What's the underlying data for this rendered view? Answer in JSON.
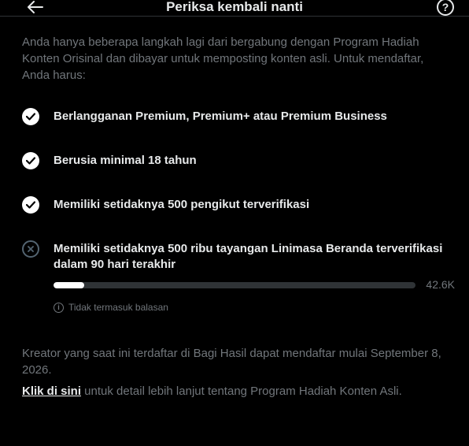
{
  "header": {
    "title": "Periksa kembali nanti",
    "help_label": "?"
  },
  "intro": "Anda hanya beberapa langkah lagi dari bergabung dengan Program Hadiah Konten Orisinal dan dibayar untuk memposting konten asli. Untuk mendaftar, Anda harus:",
  "requirements": [
    {
      "label": "Berlangganan Premium, Premium+ atau Premium Business",
      "status": "complete"
    },
    {
      "label": "Berusia minimal 18 tahun",
      "status": "complete"
    },
    {
      "label": "Memiliki setidaknya 500 pengikut terverifikasi",
      "status": "complete"
    },
    {
      "label": "Memiliki setidaknya 500 ribu tayangan Linimasa Beranda terverifikasi dalam 90 hari terakhir",
      "status": "incomplete"
    }
  ],
  "progress": {
    "value_label": "42.6K",
    "fraction": 0.0852
  },
  "note": "Tidak termasuk balasan",
  "footer": {
    "text": "Kreator yang saat ini terdaftar di Bagi Hasil dapat mendaftar mulai September 8, 2026.",
    "link_label": "Klik di sini",
    "link_suffix": " untuk detail lebih lanjut tentang Program Hadiah Konten Asli."
  },
  "colors": {
    "background": "#000000",
    "primary_text": "#e7e9ea",
    "secondary_text": "#71767b",
    "track": "#2f3336",
    "fill": "#ffffff"
  }
}
